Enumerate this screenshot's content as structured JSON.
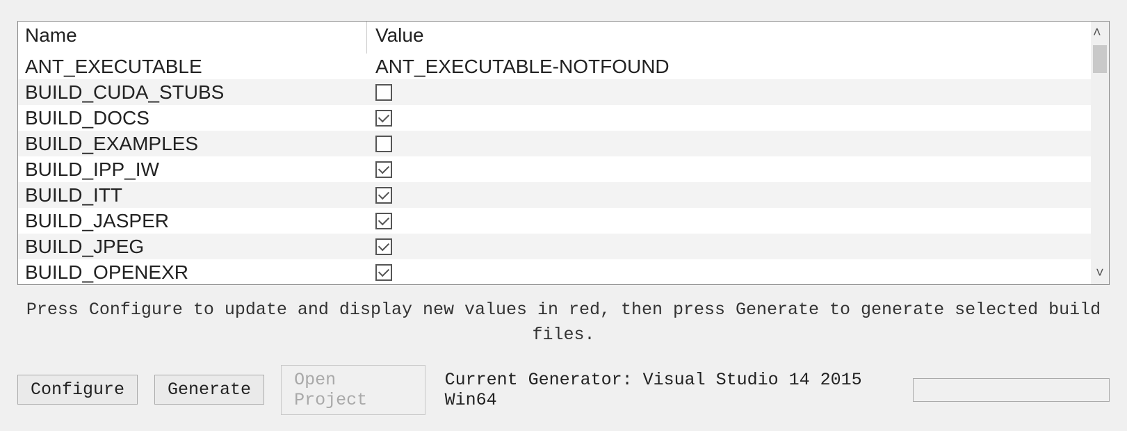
{
  "table": {
    "headers": {
      "name": "Name",
      "value": "Value"
    },
    "rows": [
      {
        "name": "ANT_EXECUTABLE",
        "type": "text",
        "value": "ANT_EXECUTABLE-NOTFOUND"
      },
      {
        "name": "BUILD_CUDA_STUBS",
        "type": "check",
        "checked": false
      },
      {
        "name": "BUILD_DOCS",
        "type": "check",
        "checked": true
      },
      {
        "name": "BUILD_EXAMPLES",
        "type": "check",
        "checked": false
      },
      {
        "name": "BUILD_IPP_IW",
        "type": "check",
        "checked": true
      },
      {
        "name": "BUILD_ITT",
        "type": "check",
        "checked": true
      },
      {
        "name": "BUILD_JASPER",
        "type": "check",
        "checked": true
      },
      {
        "name": "BUILD_JPEG",
        "type": "check",
        "checked": true
      },
      {
        "name": "BUILD_OPENEXR",
        "type": "check",
        "checked": true
      }
    ]
  },
  "hint": "Press Configure to update and display new values in red, then press Generate to generate selected build files.",
  "buttons": {
    "configure": "Configure",
    "generate": "Generate",
    "open_project": "Open Project"
  },
  "generator_label": "Current Generator: Visual Studio 14 2015 Win64",
  "scroll": {
    "up_glyph": "˄",
    "down_glyph": "˅"
  }
}
